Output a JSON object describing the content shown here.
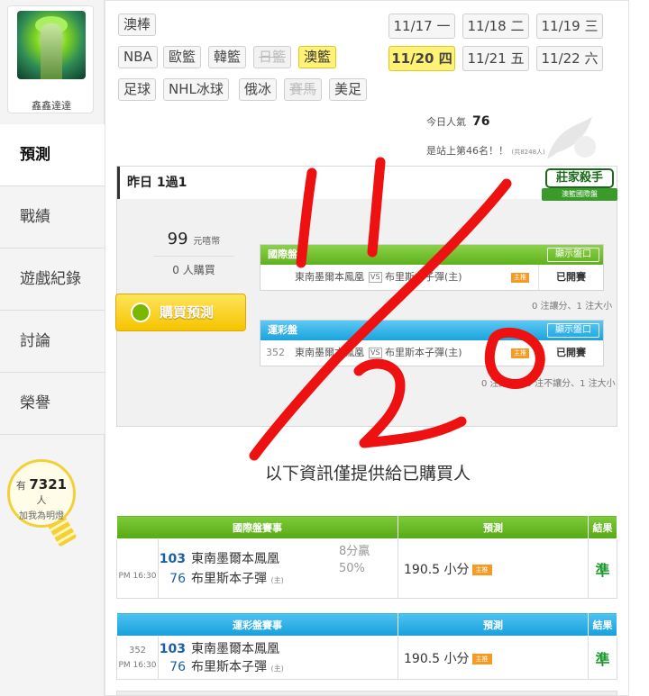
{
  "sidebar": {
    "username": "鑫鑫達達",
    "nav": [
      {
        "label": "預測",
        "active": true
      },
      {
        "label": "戰績"
      },
      {
        "label": "遊戲紀錄"
      },
      {
        "label": "討論"
      },
      {
        "label": "榮譽"
      }
    ],
    "bulb": {
      "prefix": "有",
      "count": "7321",
      "suffix": "人",
      "sub": "加我為明燈"
    }
  },
  "league_tabs": {
    "current": "澳棒",
    "row1": [
      "NBA",
      "歐籃",
      "韓籃",
      "日籃",
      "澳籃"
    ],
    "row2": [
      "足球",
      "NHL冰球",
      "俄冰",
      "賽馬",
      "美足"
    ],
    "active": "澳籃",
    "disabled": [
      "日籃",
      "賽馬"
    ]
  },
  "dates": [
    {
      "day": "11/17",
      "wd": "一"
    },
    {
      "day": "11/18",
      "wd": "二"
    },
    {
      "day": "11/19",
      "wd": "三"
    },
    {
      "day": "11/20",
      "wd": "四",
      "active": true
    },
    {
      "day": "11/21",
      "wd": "五"
    },
    {
      "day": "11/22",
      "wd": "六"
    }
  ],
  "stats": {
    "popularity_label": "今日人氣",
    "popularity_value": "76",
    "rank_text": "是站上第46名！！",
    "rank_small": "(共8248人)"
  },
  "emblem": {
    "title": "莊家殺手",
    "sub": "澳籃國際盤"
  },
  "yesterday": {
    "header": "昨日 1過1",
    "price": "99",
    "price_unit": "元嘻幣",
    "buyers": "0 人購買",
    "buy_label": "購買預測",
    "intl_title": "國際盤",
    "sport_title": "運彩盤",
    "show_label": "顯示盤口",
    "intl_match": {
      "home": "東南墨爾本鳳凰",
      "vs": "VS",
      "away": "布里斯本子彈(主)",
      "badge": "主推",
      "status": "已開賽"
    },
    "intl_note": "0 注讓分、1 注大小",
    "sport_match": {
      "no": "352",
      "home": "東南墨爾本鳳凰",
      "vs": "VS",
      "away": "布里斯本子彈(主)",
      "badge": "主推",
      "status": "已開賽"
    },
    "sport_note": "0 注讓分、0 注不讓分、1 注大小"
  },
  "notice": "以下資訊僅提供給已購買人",
  "intl_table": {
    "headers": [
      "國際盤賽事",
      "預測",
      "結果"
    ],
    "row": {
      "time": "PM 16:30",
      "home_num": "103",
      "home": "東南墨爾本鳳凰",
      "away_num": "76",
      "away": "布里斯本子彈",
      "host": "(主)",
      "meta1": "8分贏",
      "meta2": "50%",
      "pred": "190.5 小分",
      "badge": "主推",
      "result": "準"
    }
  },
  "sport_table": {
    "headers": [
      "運彩盤賽事",
      "預測",
      "結果"
    ],
    "row": {
      "no": "352",
      "time": "PM 16:30",
      "home_num": "103",
      "home": "東南墨爾本鳳凰",
      "away_num": "76",
      "away": "布里斯本子彈",
      "host": "(主)",
      "pred": "190.5 小分",
      "badge": "主推",
      "result": "準"
    }
  },
  "annotation": {
    "text": "11/20",
    "color": "#ee1111"
  }
}
